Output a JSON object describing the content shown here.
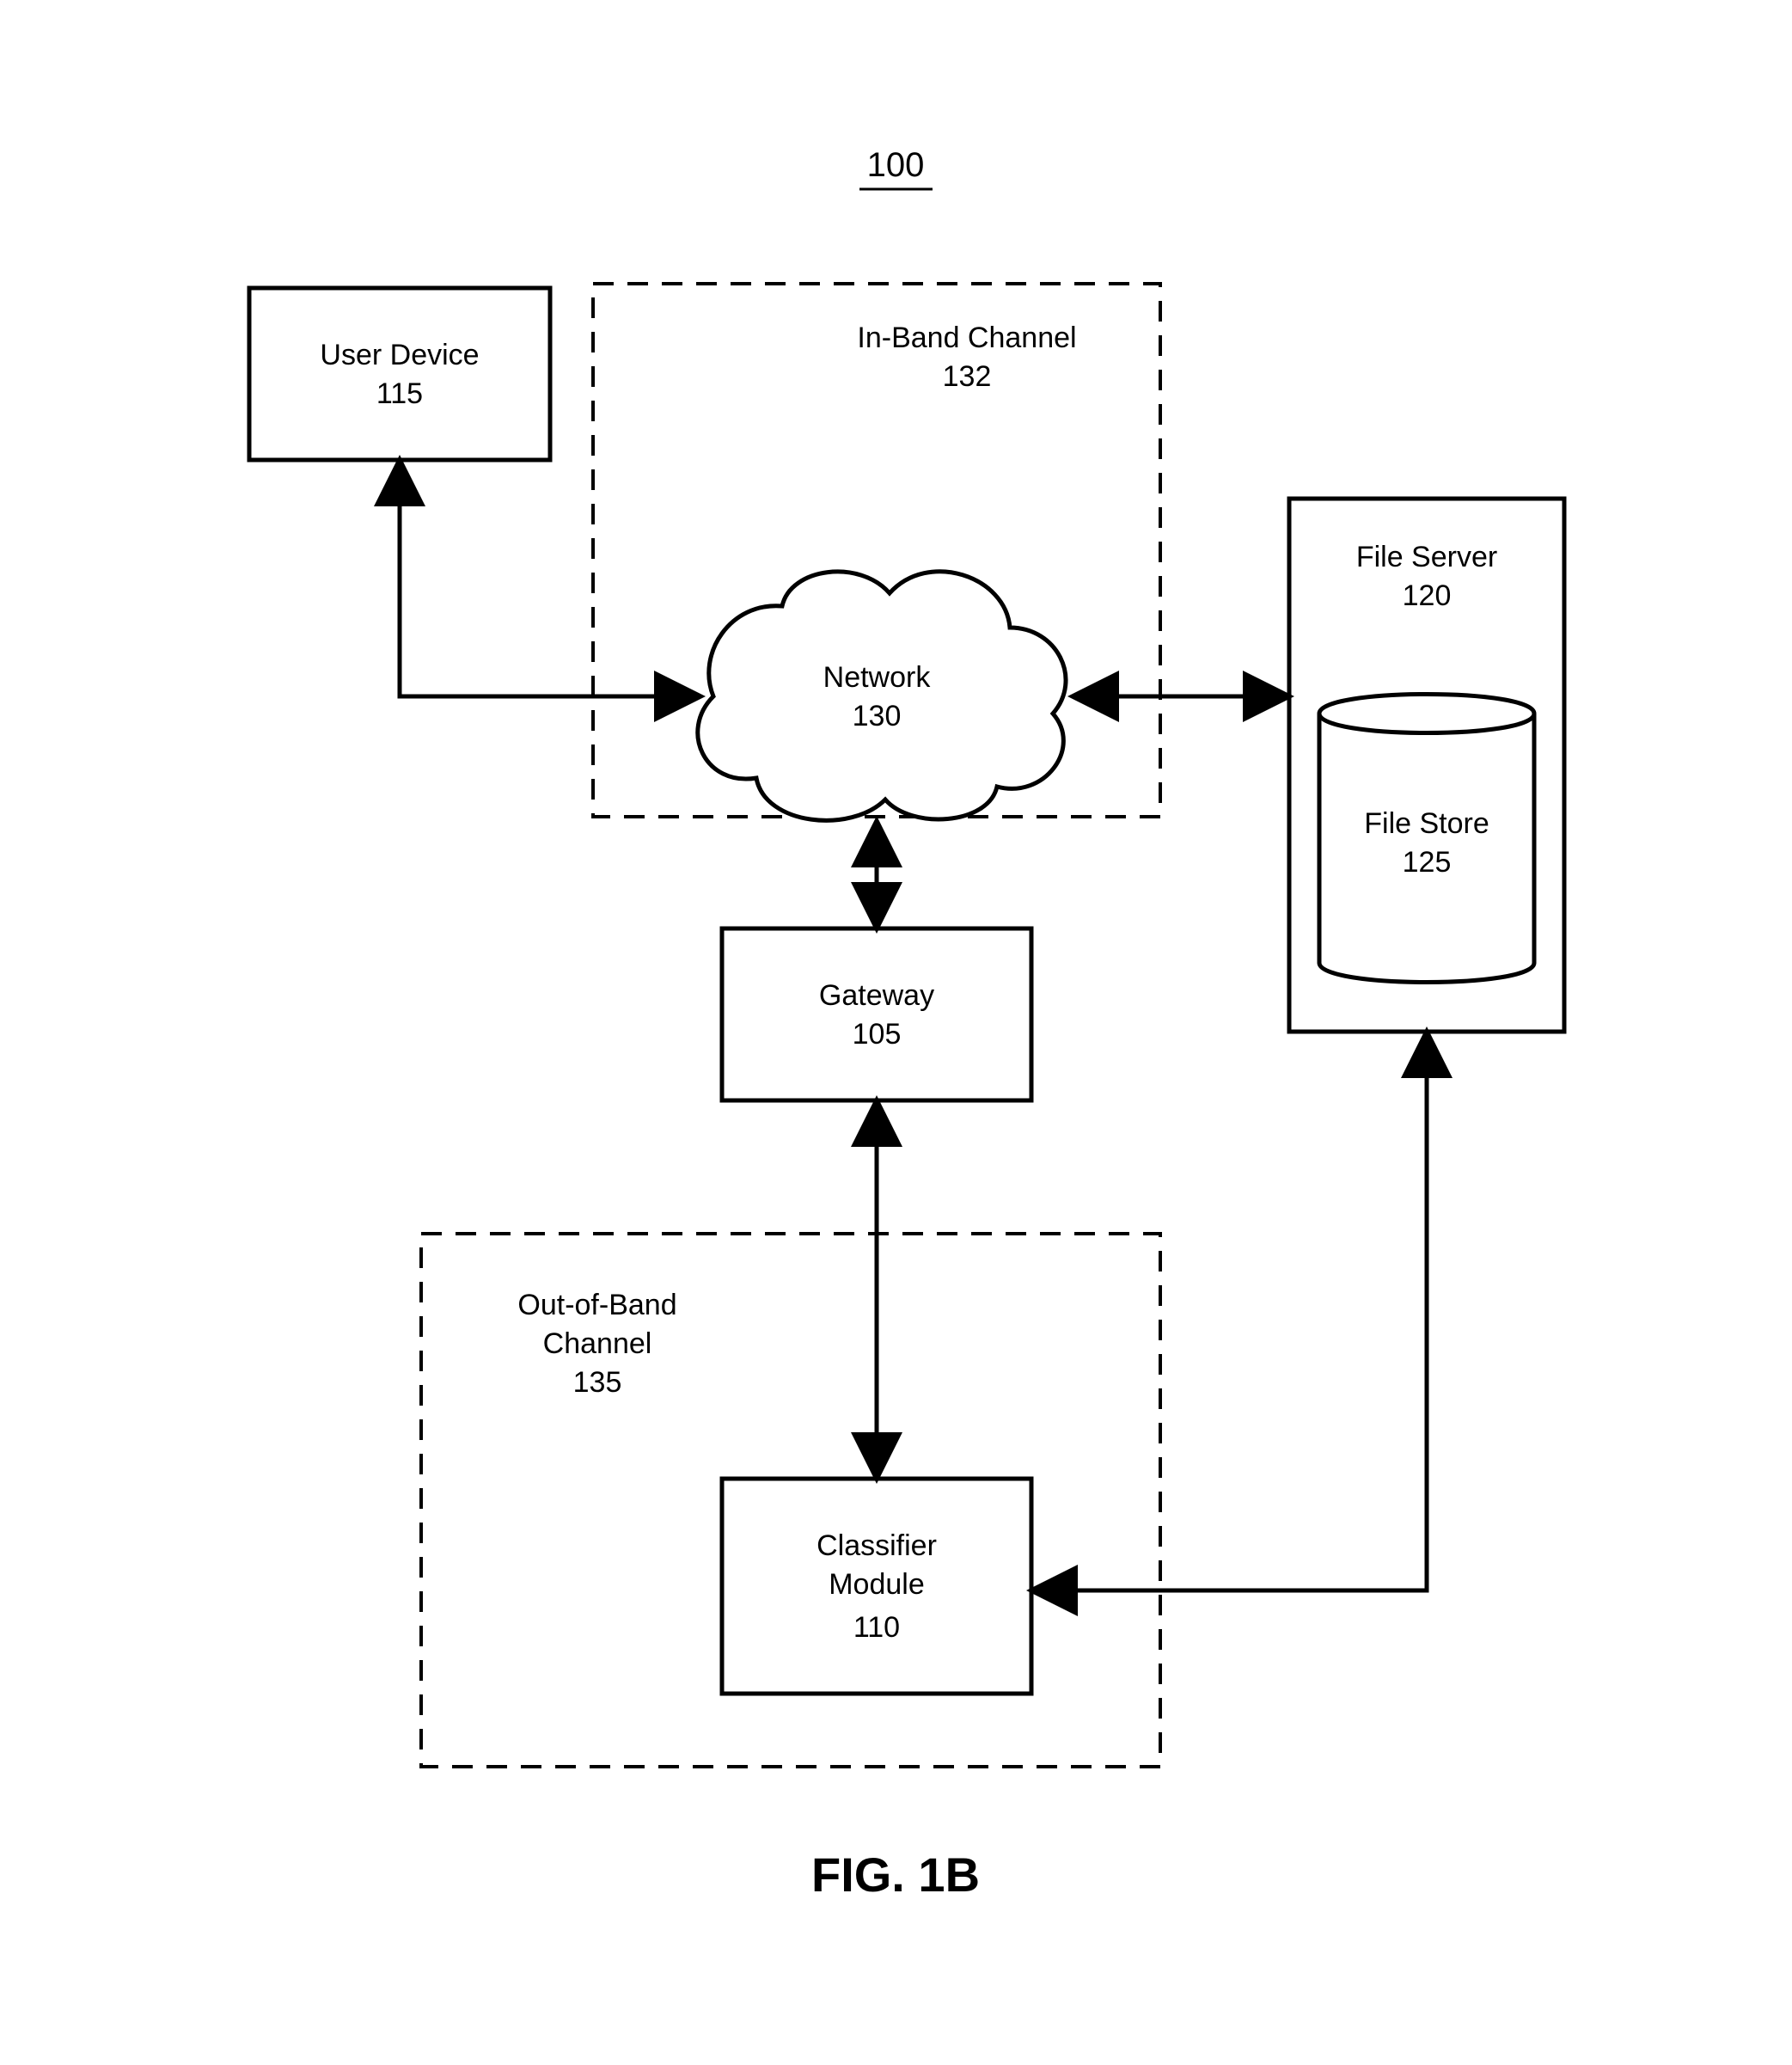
{
  "diagram_ref": "100",
  "figure_label": "FIG. 1B",
  "nodes": {
    "user_device": {
      "label": "User Device",
      "ref": "115"
    },
    "in_band": {
      "label": "In-Band Channel",
      "ref": "132"
    },
    "network": {
      "label": "Network",
      "ref": "130"
    },
    "file_server": {
      "label": "File Server",
      "ref": "120"
    },
    "file_store": {
      "label": "File Store",
      "ref": "125"
    },
    "gateway": {
      "label": "Gateway",
      "ref": "105"
    },
    "out_of_band": {
      "label": "Out-of-Band",
      "label2": "Channel",
      "ref": "135"
    },
    "classifier": {
      "label": "Classifier",
      "label2": "Module",
      "ref": "110"
    }
  }
}
